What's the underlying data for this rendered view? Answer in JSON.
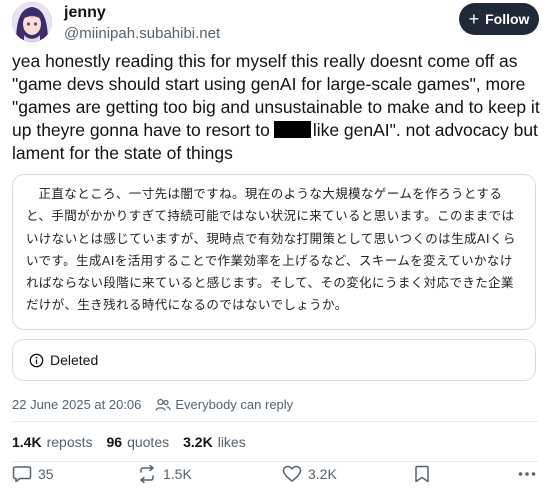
{
  "author": {
    "display_name": "jenny",
    "handle": "@miinipah.subahibi.net"
  },
  "follow_button": {
    "label": "Follow",
    "icon": "plus-icon"
  },
  "post": {
    "text_before": "yea honestly reading this for myself this really doesnt come off as \"game devs should start using genAI for large-scale games\", more \"games are getting too big and unsustainable to make and to keep it up theyre gonna have to resort to",
    "text_after": "like genAI\". not advocacy but lament for the state of things"
  },
  "quote": {
    "text": "正直なところ、一寸先は闇ですね。現在のような大規模なゲームを作ろうとすると、手間がかかりすぎて持続可能ではない状況に来ていると思います。このままではいけないとは感じていますが、現時点で有効な打開策として思いつくのは生成AIくらいです。生成AIを活用することで作業効率を上げるなど、スキームを変えていかなければならない段階に来ていると感じます。そして、その変化にうまく対応できた企業だけが、生き残れる時代になるのではないでしょうか。"
  },
  "deleted_embed": {
    "label": "Deleted",
    "icon": "info-icon"
  },
  "meta": {
    "timestamp": "22 June 2025 at 20:06",
    "reply_setting": "Everybody can reply",
    "reply_icon": "people-icon"
  },
  "stats": {
    "reposts_count": "1.4K",
    "reposts_label": "reposts",
    "quotes_count": "96",
    "quotes_label": "quotes",
    "likes_count": "3.2K",
    "likes_label": "likes"
  },
  "actions": {
    "reply_count": "35",
    "repost_count": "1.5K",
    "like_count": "3.2K"
  },
  "colors": {
    "text": "#0f1419",
    "muted": "#536471",
    "follow_bg": "#1f2937",
    "border": "#d7dce0"
  }
}
